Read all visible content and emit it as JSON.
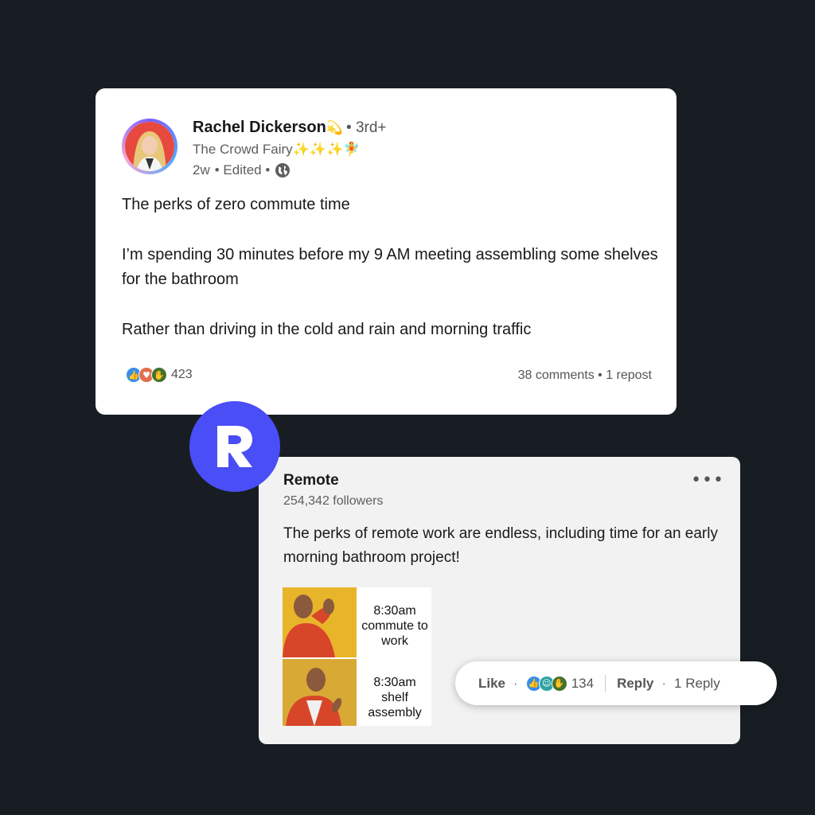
{
  "post": {
    "author_name": "Rachel Dickerson",
    "author_emoji": "💫",
    "degree": "• 3rd+",
    "headline": "The Crowd Fairy",
    "headline_emoji": "✨✨✨🧚",
    "time": "2w",
    "edited": "• Edited •",
    "globe_icon": "globe-icon",
    "lines": [
      "The perks of zero commute time",
      "I’m spending 30 minutes before my 9 AM meeting assembling some shelves for the bathroom",
      "Rather than driving in the cold and rain and morning traffic"
    ],
    "reaction_icons": [
      "like-icon",
      "love-icon",
      "support-icon"
    ],
    "reaction_count": "423",
    "engagement": "38 comments • 1 repost"
  },
  "comment": {
    "logo_icon": "remote-logo-icon",
    "brand_color": "#4a4ef6",
    "name": "Remote",
    "followers": "254,342 followers",
    "more": "•••",
    "text": "The perks of remote work are endless, including time for an early morning bathroom project!",
    "meme": {
      "top_caption": "8:30am commute to work",
      "bottom_caption": "8:30am shelf assembly"
    },
    "actions": {
      "like": "Like",
      "dot1": "·",
      "reaction_icons": [
        "like-icon",
        "celebrate-icon",
        "support-icon"
      ],
      "reaction_count": "134",
      "reply": "Reply",
      "dot2": "·",
      "replies": "1 Reply"
    }
  }
}
